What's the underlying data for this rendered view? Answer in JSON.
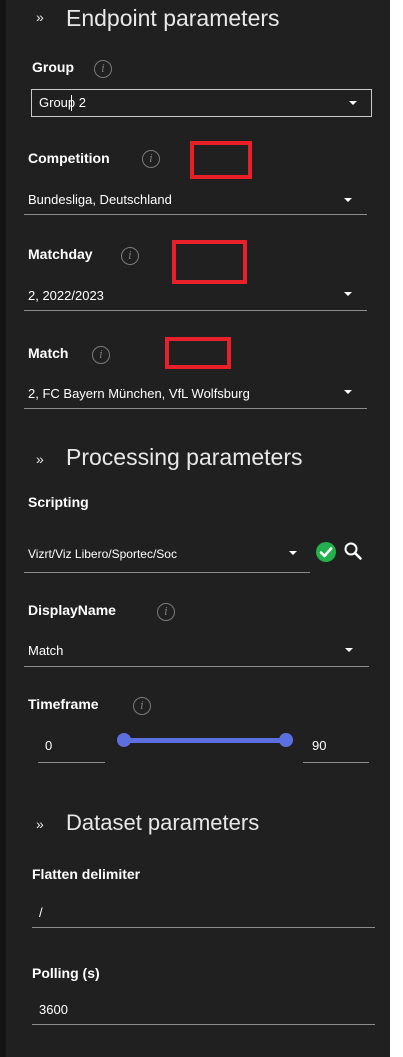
{
  "endpoint": {
    "title": "Endpoint parameters",
    "group": {
      "label": "Group",
      "value": "Group 2"
    },
    "competition": {
      "label": "Competition",
      "value": "Bundesliga, Deutschland"
    },
    "matchday": {
      "label": "Matchday",
      "value": "2, 2022/2023"
    },
    "match": {
      "label": "Match",
      "value": "2, FC Bayern München, VfL Wolfsburg"
    }
  },
  "processing": {
    "title": "Processing parameters",
    "scripting": {
      "label": "Scripting",
      "value": "Vizrt/Viz Libero/Sportec/Soc"
    },
    "display_name": {
      "label": "DisplayName",
      "value": "Match"
    },
    "timeframe": {
      "label": "Timeframe",
      "min": "0",
      "max": "90"
    }
  },
  "dataset": {
    "title": "Dataset parameters",
    "flatten": {
      "label": "Flatten delimiter",
      "value": "/"
    },
    "polling": {
      "label": "Polling (s)",
      "value": "3600"
    }
  },
  "icons": {
    "info": "info-icon",
    "chevron": "chevron-double-down-icon",
    "caret": "dropdown-caret-icon",
    "check": "check-circle-icon",
    "search": "search-icon"
  },
  "colors": {
    "panel_bg": "#202020",
    "annotation_red": "#e8202a",
    "slider_blue": "#5b6fe0",
    "check_green": "#22b14c"
  }
}
